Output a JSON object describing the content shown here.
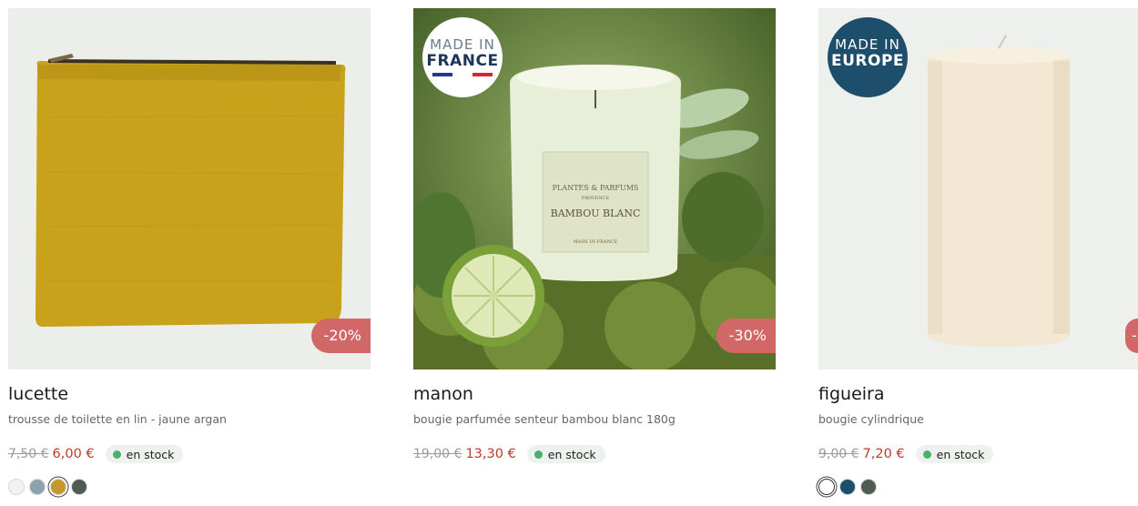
{
  "colors": {
    "discount_bg": "#d26767",
    "price_red": "#c0392b",
    "stock_dot": "#4caf6a"
  },
  "products": [
    {
      "name": "lucette",
      "description": "trousse de toilette en lin - jaune argan",
      "old_price": "7,50 €",
      "price": "6,00 €",
      "stock": "en stock",
      "discount": "-20%",
      "image": "yellow-linen-pouch",
      "swatches": [
        "#f2f2f2",
        "#8aa3ad",
        "#c6982a",
        "#4f5a55"
      ],
      "selected_swatch": 2
    },
    {
      "name": "manon",
      "description": "bougie parfumée senteur bambou blanc 180g",
      "old_price": "19,00 €",
      "price": "13,30 €",
      "stock": "en stock",
      "discount": "-30%",
      "badge": {
        "line1": "MADE IN",
        "line2": "FRANCE"
      },
      "image": "scented-candle-on-moss",
      "candle_label": {
        "brand": "PLANTES & PARFUMS",
        "sub": "PROVENCE",
        "scent": "BAMBOU BLANC",
        "made": "MADE IN FRANCE"
      }
    },
    {
      "name": "figueira",
      "description": "bougie cylindrique",
      "old_price": "9,00 €",
      "price": "7,20 €",
      "stock": "en stock",
      "discount": "-",
      "badge": {
        "line1": "MADE IN",
        "line2": "EUROPE"
      },
      "image": "cream-pillar-candle",
      "swatches": [
        "#ffffff",
        "#1d4e6b",
        "#505c52"
      ],
      "selected_swatch": 0
    }
  ]
}
